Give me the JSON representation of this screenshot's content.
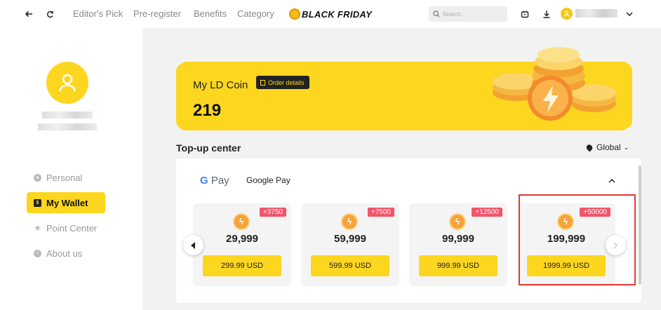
{
  "topbar": {
    "nav_links": [
      "Editor's Pick",
      "Pre-register",
      "Benefits",
      "Category"
    ],
    "promo_label": "BLACK FRIDAY",
    "search_placeholder": "Search..."
  },
  "sidebar": {
    "items": [
      {
        "label": "Personal",
        "icon": "person-icon",
        "active": false
      },
      {
        "label": "My Wallet",
        "icon": "wallet-icon",
        "active": true
      },
      {
        "label": "Point Center",
        "icon": "star-icon",
        "active": false
      },
      {
        "label": "About us",
        "icon": "info-icon",
        "active": false
      }
    ]
  },
  "wallet": {
    "title": "My LD Coin",
    "order_details_label": "Order details",
    "balance": "219"
  },
  "topup": {
    "title": "Top-up center",
    "region_label": "Global",
    "payment_method": {
      "logo": "G Pay",
      "label": "Google Pay"
    },
    "packages": [
      {
        "bonus": "+3750",
        "amount": "29,999",
        "price": "299.99 USD"
      },
      {
        "bonus": "+7500",
        "amount": "59,999",
        "price": "599.99 USD"
      },
      {
        "bonus": "+12500",
        "amount": "99,999",
        "price": "999.99 USD"
      },
      {
        "bonus": "+50000",
        "amount": "199,999",
        "price": "1999.99 USD",
        "highlighted": true
      }
    ]
  },
  "colors": {
    "accent": "#fcd61f",
    "badge": "#f2556a",
    "highlight_border": "#e53935"
  }
}
